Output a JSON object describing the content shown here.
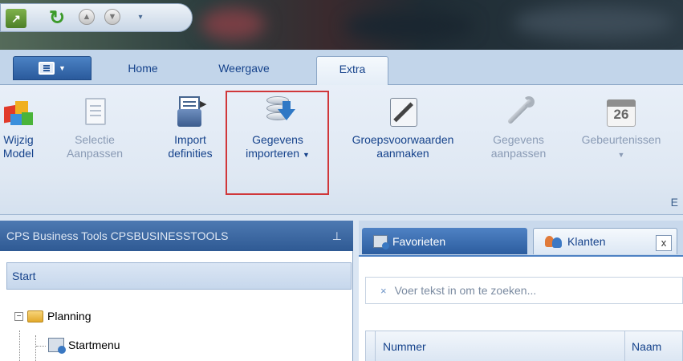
{
  "quick_access": {
    "icons": [
      "app-icon",
      "refresh-icon",
      "up-arrow-icon",
      "down-arrow-icon",
      "qat-customize-icon"
    ]
  },
  "tabs": {
    "home": "Home",
    "weergave": "Weergave",
    "extra": "Extra"
  },
  "ribbon": {
    "wijzig_model": {
      "line1": "Wijzig",
      "line2": "Model"
    },
    "selectie": {
      "line1": "Selectie",
      "line2": "Aanpassen"
    },
    "import": {
      "line1": "Import",
      "line2": "definities"
    },
    "gegevens_importeren": {
      "line1": "Gegevens",
      "line2": "importeren"
    },
    "groepsvoorwaarden": {
      "line1": "Groepsvoorwaarden",
      "line2": "aanmaken"
    },
    "gegevens_aanpassen": {
      "line1": "Gegevens",
      "line2": "aanpassen"
    },
    "gebeurtenissen": {
      "line1": "Gebeurtenissen"
    },
    "calendar_day": "26",
    "group_label": "E"
  },
  "left_panel": {
    "title": "CPS Business Tools CPSBUSINESSTOOLS",
    "pin": "&#x1F588;",
    "start": "Start",
    "tree": {
      "planning": "Planning",
      "startmenu": "Startmenu"
    }
  },
  "right_panel": {
    "tabs": {
      "favorieten": "Favorieten",
      "klanten": "Klanten"
    },
    "close": "x",
    "search_placeholder": "Voer tekst in om te zoeken...",
    "search_clear": "×",
    "columns": {
      "nummer": "Nummer",
      "naam": "Naam"
    }
  },
  "colors": {
    "accent": "#2c5d9f",
    "highlight": "#d0373a"
  }
}
